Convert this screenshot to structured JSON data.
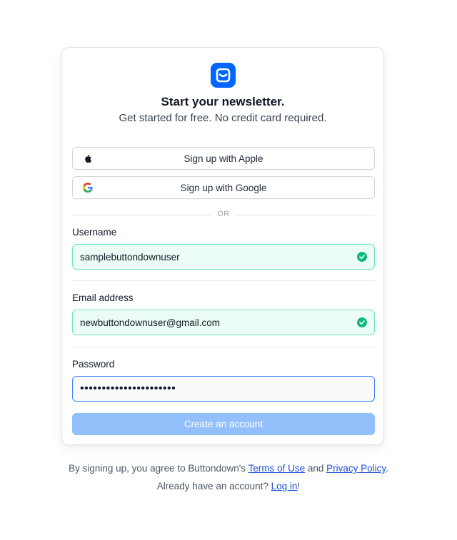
{
  "header": {
    "title": "Start your newsletter.",
    "subtitle": "Get started for free. No credit card required."
  },
  "sso": {
    "apple_label": "Sign up with Apple",
    "google_label": "Sign up with Google",
    "apple_icon": "apple-icon",
    "google_icon": "google-icon"
  },
  "separator": {
    "text": "OR"
  },
  "form": {
    "username": {
      "label": "Username",
      "value": "samplebuttondownuser",
      "status": "valid"
    },
    "email": {
      "label": "Email address",
      "value": "newbuttondownuser@gmail.com",
      "status": "valid"
    },
    "password": {
      "label": "Password",
      "value": "••••••••••••••••••••••",
      "status": "focused"
    },
    "submit_label": "Create an account"
  },
  "footer": {
    "terms_prefix": "By signing up, you agree to Buttondown's ",
    "terms_link": "Terms of Use",
    "terms_and": " and ",
    "privacy_link": "Privacy Policy",
    "terms_suffix": ".",
    "login_prefix": "Already have an account? ",
    "login_link": "Log in",
    "login_suffix": "!"
  },
  "colors": {
    "brand": "#0066ff",
    "valid_bg": "#ecfdf5",
    "valid_border": "#6ee7b7",
    "valid_check": "#10b981",
    "focus_border": "#3b82f6",
    "submit_disabled": "#93c0fb",
    "link": "#1d4ed8"
  }
}
